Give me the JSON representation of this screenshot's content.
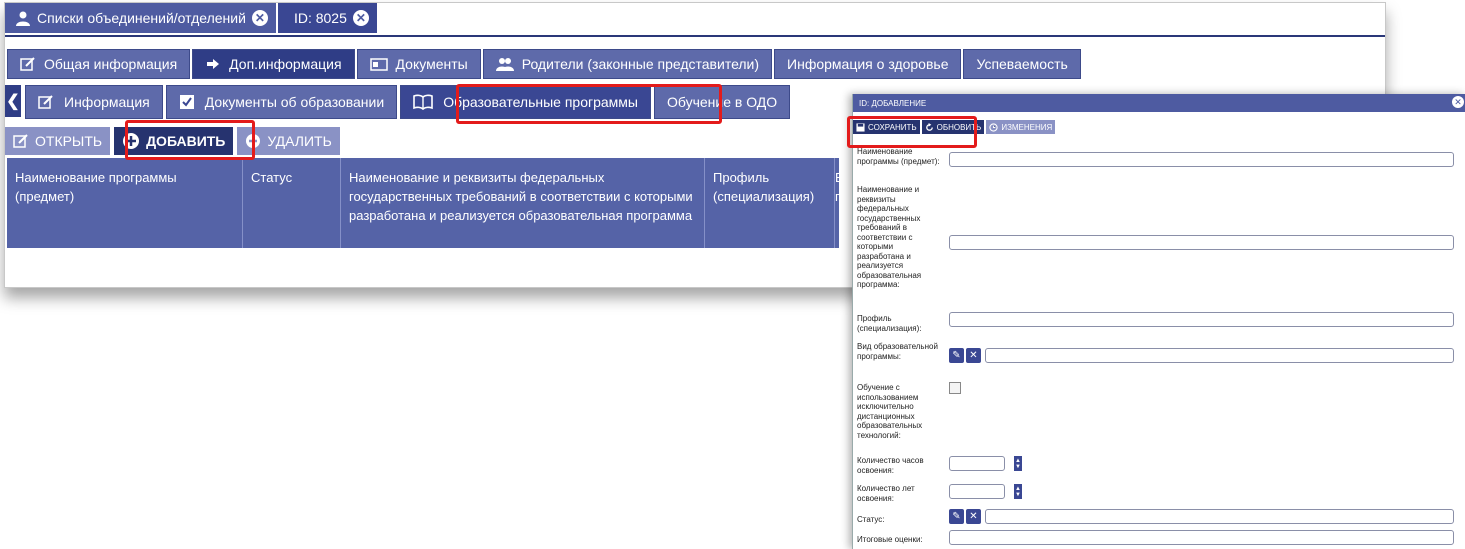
{
  "header_tabs": [
    {
      "label": "Списки объединений/отделений"
    },
    {
      "label": "ID: 8025"
    }
  ],
  "main_tabs": [
    {
      "label": "Общая информация"
    },
    {
      "label": "Доп.информация"
    },
    {
      "label": "Документы"
    },
    {
      "label": "Родители (законные представители)"
    },
    {
      "label": "Информация о здоровье"
    },
    {
      "label": "Успеваемость"
    }
  ],
  "sub_tabs": [
    {
      "label": "Информация"
    },
    {
      "label": "Документы об образовании"
    },
    {
      "label": "Образовательные программы"
    },
    {
      "label": "Обучение в ОДО"
    }
  ],
  "toolbar": {
    "open": "ОТКРЫТЬ",
    "add": "ДОБАВИТЬ",
    "delete": "УДАЛИТЬ"
  },
  "grid_columns": [
    "Наименование программы (предмет)",
    "Статус",
    "Наименование и реквизиты федеральных государственных требований в соответствии с которыми разработана и реализуется образовательная программа",
    "Профиль (специализация)",
    "В пр"
  ],
  "dialog": {
    "title": "ID: ДОБАВЛЕНИЕ",
    "save": "СОХРАНИТЬ",
    "refresh": "ОБНОВИТЬ",
    "changes": "ИЗМЕНЕНИЯ",
    "fields": {
      "program_name": "Наименование программы (предмет):",
      "requirements": "Наименование и реквизиты федеральных государственных требований в соответствии с которыми разработана и реализуется образовательная программа:",
      "profile": "Профиль (специализация):",
      "program_type": "Вид образовательной программы:",
      "distance": "Обучение с использованием исключительно дистанционных образовательных технологий:",
      "hours": "Количество часов освоения:",
      "years": "Количество лет освоения:",
      "status": "Статус:",
      "grades": "Итоговые оценки:"
    }
  },
  "colors": {
    "primary": "#4e5ba1",
    "dark": "#26336f",
    "highlight": "#e31b1b"
  }
}
